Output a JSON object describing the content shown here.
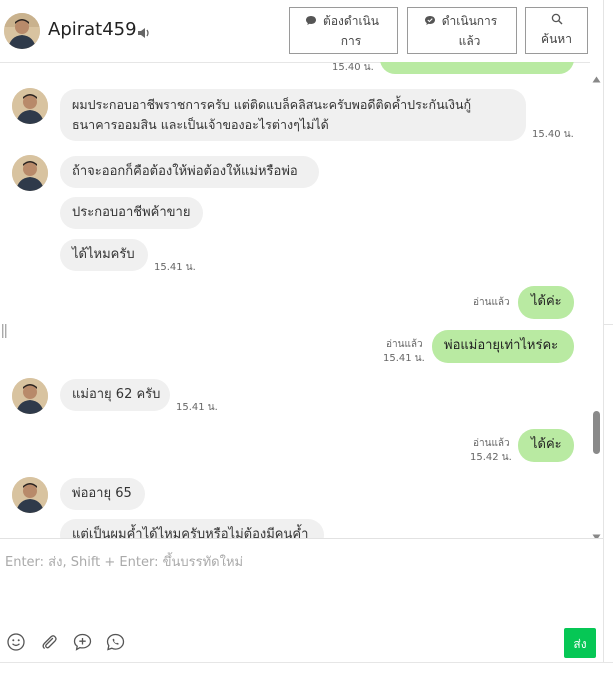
{
  "header": {
    "name": "Apirat459",
    "buttons": {
      "pending": "ต้องดำเนินการ",
      "done": "ดำเนินการแล้ว",
      "search": "ค้นหา"
    }
  },
  "messages": {
    "partial_time": "15.40 น.",
    "m1_line1": "ผมประกอบอาชีพราชการครับ แต่ติดแบล็คลิสนะครับพอดีติดค้ำประกันเงินกู้",
    "m1_line2": "ธนาคารออมสิน และเป็นเจ้าของอะไรต่างๆไม่ได้",
    "m1_time": "15.40 น.",
    "m2": "ถ้าจะออกก็คือต้องให้พ่อต้องให้แม่หรือพ่อ",
    "m3": "ประกอบอาชีพค้าขาย",
    "m4": "ได้ไหมครับ",
    "m4_time": "15.41 น.",
    "o1": "ได้ค่ะ",
    "o1_read": "อ่านแล้ว",
    "o2": "พ่อแม่อายุเท่าไหร่คะ",
    "o2_read": "อ่านแล้ว",
    "o2_time": "15.41 น.",
    "m5": "แม่อายุ 62 ครับ",
    "m5_time": "15.41 น.",
    "o3": "ได้ค่ะ",
    "o3_read": "อ่านแล้ว",
    "o3_time": "15.42 น.",
    "m6": "พ่ออายุ 65",
    "m7_partial": "แต่เป็นผมค้ำได้ไหมครับหรือไม่ต้องมีคนค้ำ"
  },
  "composer": {
    "placeholder": "Enter: ส่ง, Shift + Enter: ขึ้นบรรทัดใหม่",
    "send_label": "ส่ง"
  },
  "colors": {
    "outgoing_bubble": "#b9eaa2",
    "incoming_bubble": "#f0f0f0",
    "send_button": "#06c755"
  }
}
